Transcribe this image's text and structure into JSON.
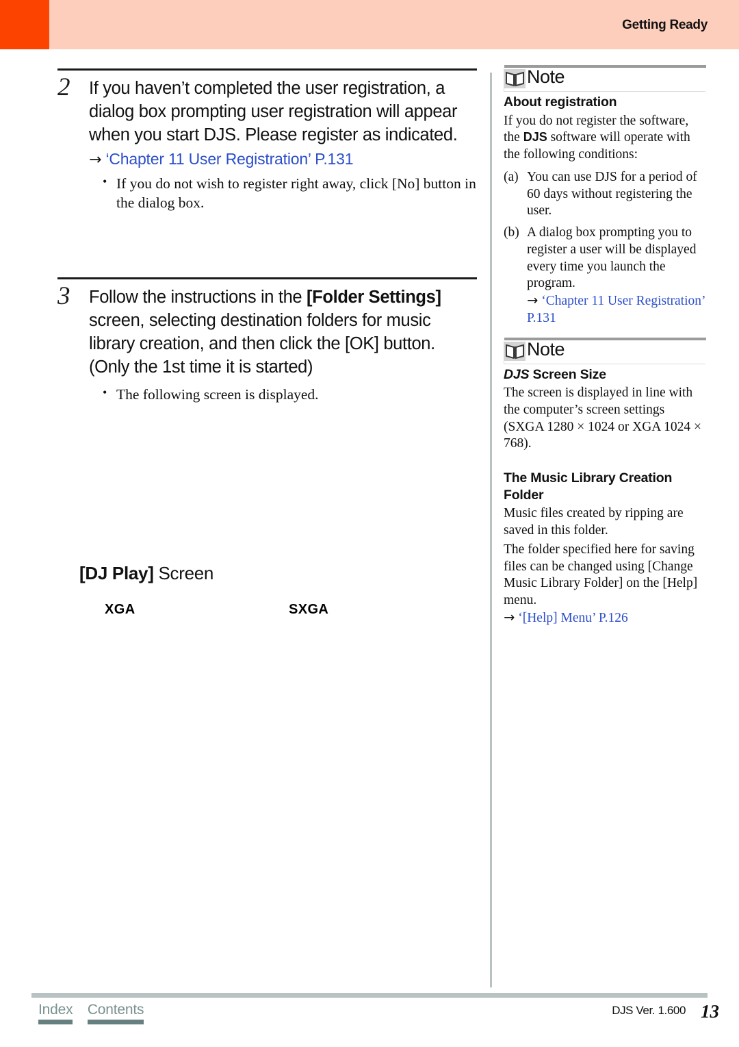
{
  "header": {
    "title": "Getting Ready",
    "accent_color": "#fc4300",
    "band_color": "#fecebc"
  },
  "steps": [
    {
      "number": "2",
      "text_parts": [
        {
          "text": "If you haven’t completed the user registration, a dialog box prompting user registration will appear when you start DJS. Please register as indicated.",
          "bold": false
        }
      ],
      "heading": "If you haven’t completed the user registration, a dialog box prompting user registration will appear when you start DJS. Please register as indicated.",
      "xref": {
        "arrow": "→",
        "text": "‘Chapter 11  User Registration’ P.131",
        "color": "#2b4ecb"
      },
      "bullets": [
        "If you do not wish to register right away, click [No] button in the dialog box."
      ]
    },
    {
      "number": "3",
      "heading_pre": "Follow the instructions in the ",
      "heading_bold": "[Folder Settings]",
      "heading_post": " screen, selecting destination folders for music library creation, and then click the [OK] button. (Only the 1st time it is started)",
      "bullets": [
        "The following screen is displayed."
      ]
    }
  ],
  "djplay": {
    "title_bold": "[DJ Play]",
    "title_rest": " Screen",
    "resolutions": {
      "xga": "XGA",
      "sxga": "SXGA"
    }
  },
  "notes": [
    {
      "label": "Note",
      "icon": "open-book-icon",
      "subtitle": "About registration",
      "body": "If you do not register the software, the DJS software will operate with the following conditions:",
      "body_pre": "If you do not register the software, the ",
      "body_djs": "DJS",
      "body_post": " software will operate with the following conditions:",
      "list": [
        {
          "marker": "(a)",
          "text_pre": "You can use ",
          "text_djs": "DJS",
          "text_post": " for a period of 60 days without registering the user."
        },
        {
          "marker": "(b)",
          "text_pre": "A dialog box prompting you to register a user will be displayed every time you launch the program.",
          "text_djs": "",
          "text_post": ""
        }
      ],
      "xref": {
        "arrow": "→",
        "text": "‘Chapter 11  User Registration’ P.131",
        "color": "#2b4ecb"
      }
    },
    {
      "label": "Note",
      "icon": "open-book-icon",
      "subtitle_italic": "DJS",
      "subtitle_rest": " Screen Size",
      "body": "The screen is displayed in line with the computer’s screen settings (SXGA 1280 × 1024 or XGA 1024 × 768).",
      "subtitle2": "The Music Library Creation Folder",
      "body2": "Music files created by ripping are saved in this folder.",
      "body3": "The folder specified here for saving files can be changed using [Change Music Library Folder] on the [Help] menu.",
      "xref": {
        "arrow": "→",
        "text": "‘[Help] Menu’ P.126",
        "color": "#2b4ecb"
      }
    }
  ],
  "footer": {
    "tabs": [
      {
        "label": "Index"
      },
      {
        "label": "Contents"
      }
    ],
    "version": "DJS Ver.  1.600",
    "page_number": "13",
    "rule_color": "#b9c2c2",
    "tab_color": "#66807f"
  }
}
